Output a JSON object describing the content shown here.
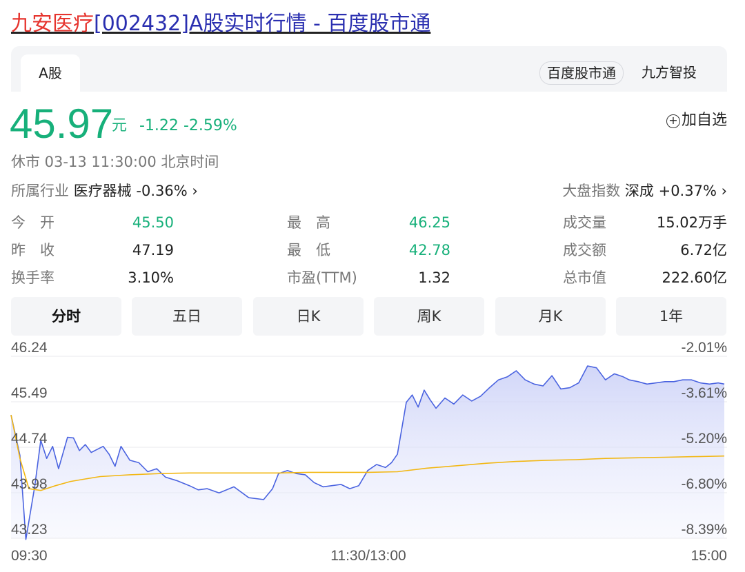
{
  "title": {
    "highlight": "九安医疗",
    "rest": "[002432]A股实时行情 - 百度股市通"
  },
  "tabs": {
    "market": "A股"
  },
  "sources": {
    "baidu": "百度股市通",
    "jiufang": "九方智投"
  },
  "quote": {
    "price": "45.97",
    "unit": "元",
    "change": "-1.22",
    "change_pct": "-2.59%",
    "watch_plus": "+",
    "watch_label": "加自选"
  },
  "status": {
    "text": "休市  03-13 11:30:00  北京时间"
  },
  "industry": {
    "label": "所属行业",
    "name": "医疗器械",
    "change": "-0.36%",
    "arrow": "›"
  },
  "index": {
    "label": "大盘指数",
    "name": "深成",
    "change": "+0.37%",
    "arrow": "›"
  },
  "stats": {
    "open_label": "今　开",
    "open": "45.50",
    "prev_close_label": "昨　收",
    "prev_close": "47.19",
    "turnover_rate_label": "换手率",
    "turnover_rate": "3.10%",
    "high_label": "最　高",
    "high": "46.25",
    "low_label": "最　低",
    "low": "42.78",
    "pe_label": "市盈(TTM)",
    "pe": "1.32",
    "volume_label": "成交量",
    "volume": "15.02万手",
    "amount_label": "成交额",
    "amount": "6.72亿",
    "market_cap_label": "总市值",
    "market_cap": "222.60亿"
  },
  "periods": [
    "分时",
    "五日",
    "日K",
    "周K",
    "月K",
    "1年"
  ],
  "colors": {
    "up_green": "#17b07a",
    "price_line": "#4a63e0",
    "avg_line": "#f2b713",
    "title_red": "#e6342e",
    "title_blue": "#2a2fb0"
  },
  "chart_data": {
    "type": "line",
    "y_left_ticks": [
      "46.24",
      "45.49",
      "44.74",
      "43.98",
      "43.23"
    ],
    "y_right_ticks": [
      "-2.01%",
      "-3.61%",
      "-5.20%",
      "-6.80%",
      "-8.39%"
    ],
    "x_ticks": [
      "09:30",
      "11:30/13:00",
      "15:00"
    ],
    "ylim": [
      43.23,
      46.24
    ],
    "session_minutes": 240,
    "series": [
      {
        "role": "price",
        "x": [
          0,
          3,
          5,
          8,
          10,
          12,
          14,
          16,
          19,
          21,
          23,
          25,
          27,
          29,
          31,
          33,
          35,
          37,
          40,
          43,
          46,
          49,
          52,
          56,
          60,
          63,
          66,
          70,
          75,
          80,
          85,
          88,
          90,
          93,
          96,
          99,
          102,
          105,
          108,
          111,
          114,
          117,
          120,
          123,
          126,
          128,
          130,
          133,
          135,
          137,
          139,
          141,
          143,
          146,
          149,
          152,
          155,
          158,
          161,
          164,
          167,
          170,
          173,
          176,
          179,
          182,
          185,
          188,
          191,
          194,
          197,
          200,
          203,
          206,
          208,
          211,
          214,
          217,
          220,
          223,
          226,
          229,
          232,
          235,
          238,
          240
        ],
        "y": [
          45.27,
          44.6,
          43.21,
          44.1,
          44.85,
          44.55,
          44.75,
          44.38,
          44.9,
          44.89,
          44.68,
          44.78,
          44.65,
          44.7,
          44.75,
          44.62,
          44.42,
          44.75,
          44.52,
          44.48,
          44.33,
          44.38,
          44.24,
          44.18,
          44.1,
          44.03,
          44.05,
          43.98,
          44.08,
          43.9,
          43.87,
          44.05,
          44.3,
          44.35,
          44.3,
          44.28,
          44.15,
          44.08,
          44.1,
          44.12,
          44.05,
          44.1,
          44.35,
          44.45,
          44.4,
          44.48,
          44.62,
          45.48,
          45.6,
          45.4,
          45.68,
          45.52,
          45.38,
          45.55,
          45.45,
          45.6,
          45.5,
          45.58,
          45.72,
          45.85,
          45.9,
          46.0,
          45.85,
          45.78,
          45.75,
          45.92,
          45.7,
          45.72,
          45.8,
          46.08,
          46.05,
          45.85,
          45.95,
          45.9,
          45.85,
          45.82,
          45.78,
          45.8,
          45.82,
          45.82,
          45.85,
          45.85,
          45.8,
          45.78,
          45.8,
          45.78
        ]
      },
      {
        "role": "average",
        "x": [
          0,
          3,
          6,
          10,
          15,
          20,
          25,
          30,
          40,
          50,
          60,
          70,
          80,
          90,
          100,
          110,
          120,
          130,
          140,
          150,
          160,
          170,
          180,
          190,
          200,
          210,
          220,
          230,
          240
        ],
        "y": [
          45.27,
          44.55,
          44.05,
          44.02,
          44.1,
          44.17,
          44.21,
          44.25,
          44.28,
          44.3,
          44.31,
          44.31,
          44.31,
          44.31,
          44.32,
          44.32,
          44.32,
          44.33,
          44.39,
          44.43,
          44.47,
          44.5,
          44.52,
          44.53,
          44.55,
          44.56,
          44.57,
          44.58,
          44.59
        ]
      }
    ]
  }
}
